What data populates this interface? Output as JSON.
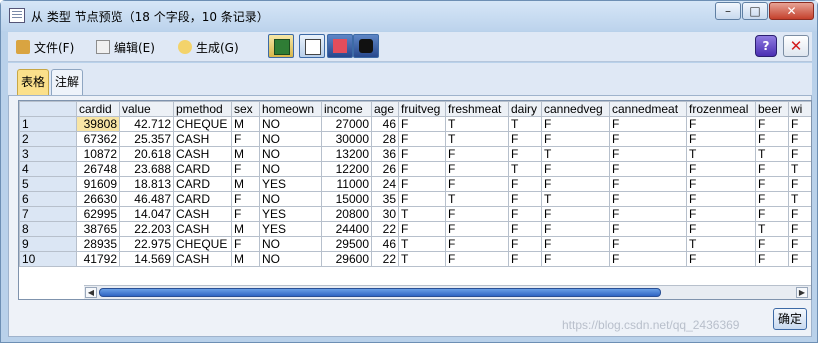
{
  "window": {
    "title": "从 类型 节点预览（18 个字段，10 条记录）",
    "min_glyph": "–",
    "max_glyph": "□",
    "close_glyph": "✕"
  },
  "menu": {
    "file": "文件(F)",
    "edit": "编辑(E)",
    "generate": "生成(G)",
    "help_glyph": "?",
    "close_glyph": "✕"
  },
  "tabs": {
    "table": "表格",
    "notes": "注解"
  },
  "grid": {
    "columns": [
      "cardid",
      "value",
      "pmethod",
      "sex",
      "homeown",
      "income",
      "age",
      "fruitveg",
      "freshmeat",
      "dairy",
      "cannedveg",
      "cannedmeat",
      "frozenmeal",
      "beer",
      "wi"
    ],
    "rows": [
      [
        "1",
        "39808",
        "42.712",
        "CHEQUE",
        "M",
        "NO",
        "27000",
        "46",
        "F",
        "T",
        "T",
        "F",
        "F",
        "F",
        "F",
        "F"
      ],
      [
        "2",
        "67362",
        "25.357",
        "CASH",
        "F",
        "NO",
        "30000",
        "28",
        "F",
        "T",
        "F",
        "F",
        "F",
        "F",
        "F",
        "F"
      ],
      [
        "3",
        "10872",
        "20.618",
        "CASH",
        "M",
        "NO",
        "13200",
        "36",
        "F",
        "F",
        "F",
        "T",
        "F",
        "T",
        "T",
        "F"
      ],
      [
        "4",
        "26748",
        "23.688",
        "CARD",
        "F",
        "NO",
        "12200",
        "26",
        "F",
        "F",
        "T",
        "F",
        "F",
        "F",
        "F",
        "T"
      ],
      [
        "5",
        "91609",
        "18.813",
        "CARD",
        "M",
        "YES",
        "11000",
        "24",
        "F",
        "F",
        "F",
        "F",
        "F",
        "F",
        "F",
        "F"
      ],
      [
        "6",
        "26630",
        "46.487",
        "CARD",
        "F",
        "NO",
        "15000",
        "35",
        "F",
        "T",
        "F",
        "T",
        "F",
        "F",
        "F",
        "T"
      ],
      [
        "7",
        "62995",
        "14.047",
        "CASH",
        "F",
        "YES",
        "20800",
        "30",
        "T",
        "F",
        "F",
        "F",
        "F",
        "F",
        "F",
        "F"
      ],
      [
        "8",
        "38765",
        "22.203",
        "CASH",
        "M",
        "YES",
        "24400",
        "22",
        "F",
        "F",
        "F",
        "F",
        "F",
        "F",
        "T",
        "F"
      ],
      [
        "9",
        "28935",
        "22.975",
        "CHEQUE",
        "F",
        "NO",
        "29500",
        "46",
        "T",
        "F",
        "F",
        "F",
        "F",
        "T",
        "F",
        "F"
      ],
      [
        "10",
        "41792",
        "14.569",
        "CASH",
        "M",
        "NO",
        "29600",
        "22",
        "T",
        "F",
        "F",
        "F",
        "F",
        "F",
        "F",
        "F"
      ]
    ]
  },
  "buttons": {
    "ok": "确定"
  },
  "watermark": "https://blog.csdn.net/qq_2436369",
  "icons": {
    "title": "table-window-icon",
    "file": "folder-icon",
    "edit": "notepad-icon",
    "generate": "lightbulb-icon",
    "toolbar": [
      "table-view-icon",
      "print-icon",
      "sort-icon",
      "binoculars-icon"
    ]
  },
  "colors": {
    "selected_cell": "#f8e5a5",
    "active_tab": "#fbe08b",
    "scroll_thumb": "#3a73d1",
    "close_button": "#c4402c"
  }
}
